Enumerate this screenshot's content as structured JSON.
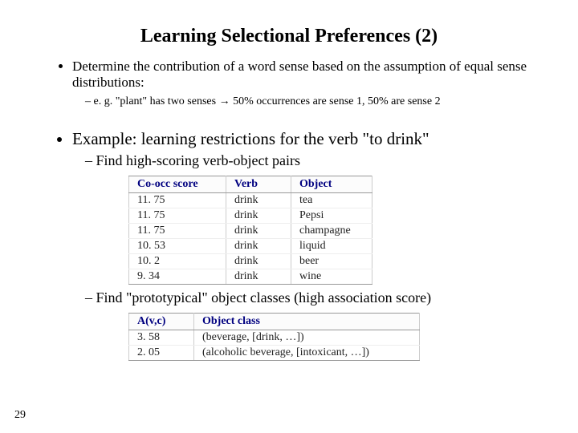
{
  "title": "Learning Selectional Preferences (2)",
  "bullet1": "Determine the contribution of a word sense based on the assumption of equal sense distributions:",
  "sub1_prefix": "e. g. \"plant\" has two senses ",
  "sub1_suffix": " 50% occurrences are sense 1, 50% are sense 2",
  "arrow": "→",
  "bullet2": "Example: learning restrictions for the verb \"to drink\"",
  "sub2a": "Find high-scoring verb-object pairs",
  "sub2b": "Find \"prototypical\" object classes (high association score)",
  "table1": {
    "headers": [
      "Co-occ score",
      "Verb",
      "Object"
    ],
    "rows": [
      [
        "11. 75",
        "drink",
        "tea"
      ],
      [
        "11. 75",
        "drink",
        "Pepsi"
      ],
      [
        "11. 75",
        "drink",
        "champagne"
      ],
      [
        "10. 53",
        "drink",
        "liquid"
      ],
      [
        "10. 2",
        "drink",
        "beer"
      ],
      [
        "9. 34",
        "drink",
        "wine"
      ]
    ]
  },
  "table2": {
    "headers": [
      "A(v,c)",
      "Object class"
    ],
    "rows": [
      [
        "3. 58",
        "(beverage, [drink, …])"
      ],
      [
        "2. 05",
        "(alcoholic beverage, [intoxicant, …])"
      ]
    ]
  },
  "page": "29"
}
